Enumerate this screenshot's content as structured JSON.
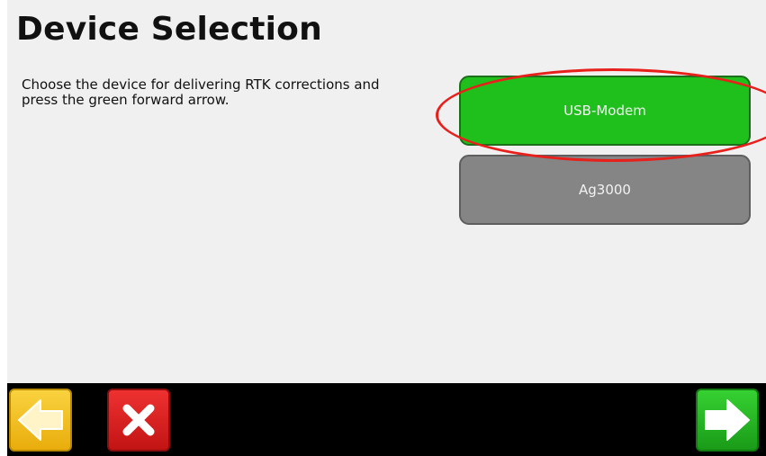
{
  "page": {
    "title": "Device Selection",
    "instructions": "Choose the device for delivering RTK corrections and press the green forward arrow."
  },
  "devices": [
    {
      "label": "USB-Modem",
      "state": "selected",
      "color": "#1fbf1c"
    },
    {
      "label": "Ag3000",
      "state": "unselected",
      "color": "#858585"
    }
  ],
  "highlight": {
    "color": "#e8201c",
    "target": "USB-Modem"
  },
  "nav": {
    "back": {
      "icon": "arrow-left-icon",
      "color": "#f3c21f"
    },
    "cancel": {
      "icon": "close-x-icon",
      "color": "#d61f1f"
    },
    "forward": {
      "icon": "arrow-right-icon",
      "color": "#26b823"
    }
  }
}
